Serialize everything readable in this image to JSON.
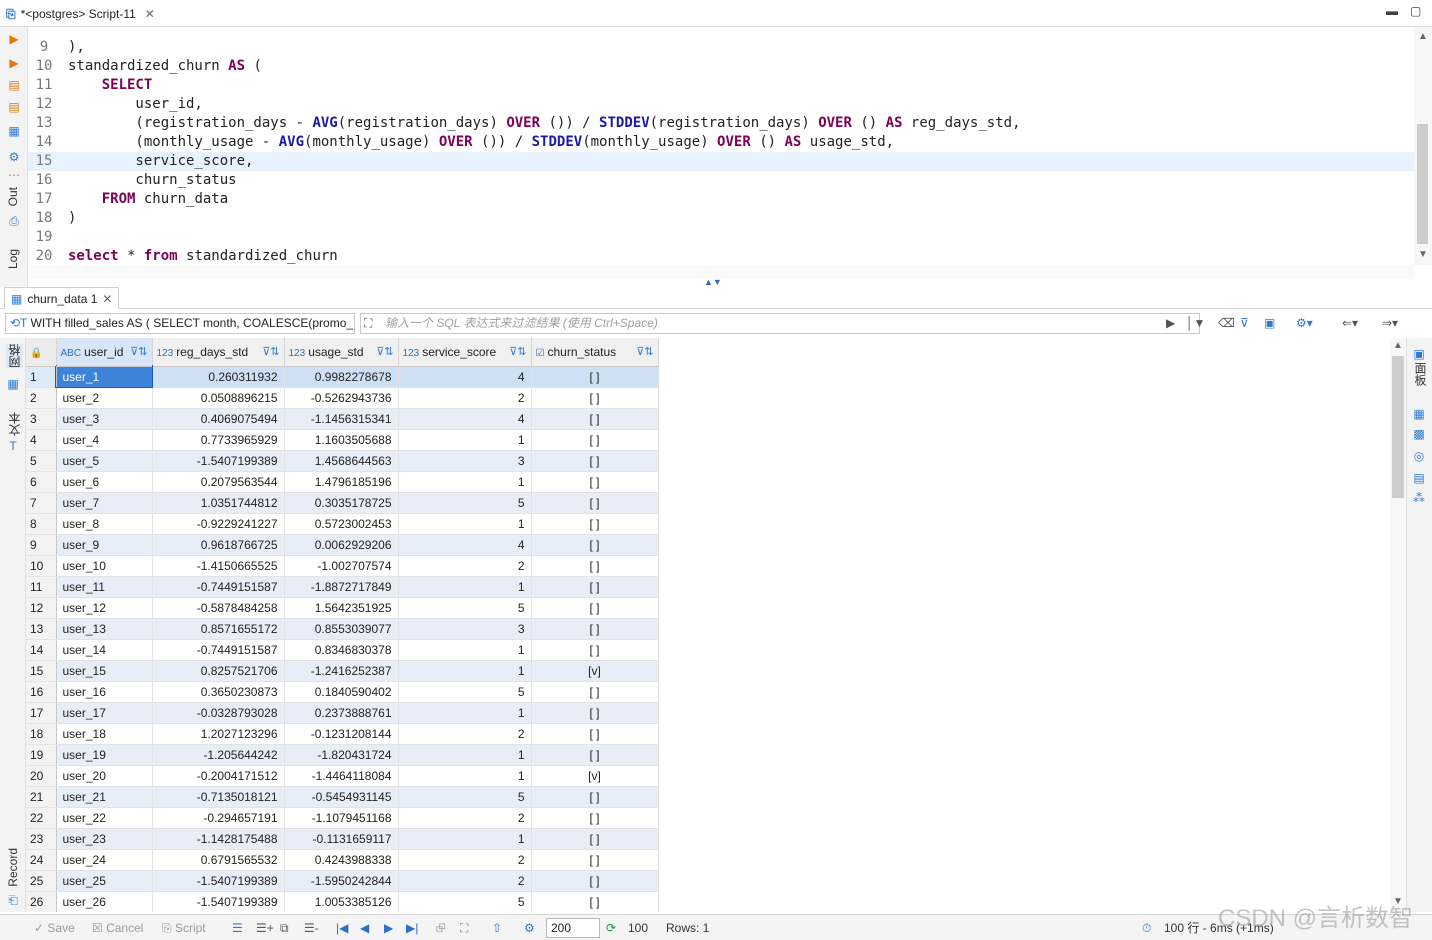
{
  "editor": {
    "tab_title": "*<postgres> Script-11",
    "lines": [
      {
        "n": "9",
        "parts": [
          {
            "t": "),",
            "k": ""
          }
        ]
      },
      {
        "n": "10",
        "parts": [
          {
            "t": "standardized_churn ",
            "k": ""
          },
          {
            "t": "AS",
            "k": "kw"
          },
          {
            "t": " (",
            "k": ""
          }
        ]
      },
      {
        "n": "11",
        "parts": [
          {
            "t": "    ",
            "k": ""
          },
          {
            "t": "SELECT",
            "k": "kw"
          }
        ]
      },
      {
        "n": "12",
        "parts": [
          {
            "t": "        user_id,",
            "k": ""
          }
        ]
      },
      {
        "n": "13",
        "parts": [
          {
            "t": "        (registration_days - ",
            "k": ""
          },
          {
            "t": "AVG",
            "k": "kw2"
          },
          {
            "t": "(registration_days) ",
            "k": ""
          },
          {
            "t": "OVER",
            "k": "kw"
          },
          {
            "t": " ()) / ",
            "k": ""
          },
          {
            "t": "STDDEV",
            "k": "kw2"
          },
          {
            "t": "(registration_days) ",
            "k": ""
          },
          {
            "t": "OVER",
            "k": "kw"
          },
          {
            "t": " () ",
            "k": ""
          },
          {
            "t": "AS",
            "k": "kw"
          },
          {
            "t": " reg_days_std,",
            "k": ""
          }
        ]
      },
      {
        "n": "14",
        "parts": [
          {
            "t": "        (monthly_usage - ",
            "k": ""
          },
          {
            "t": "AVG",
            "k": "kw2"
          },
          {
            "t": "(monthly_usage) ",
            "k": ""
          },
          {
            "t": "OVER",
            "k": "kw"
          },
          {
            "t": " ()) / ",
            "k": ""
          },
          {
            "t": "STDDEV",
            "k": "kw2"
          },
          {
            "t": "(monthly_usage) ",
            "k": ""
          },
          {
            "t": "OVER",
            "k": "kw"
          },
          {
            "t": " () ",
            "k": ""
          },
          {
            "t": "AS",
            "k": "kw"
          },
          {
            "t": " usage_std,",
            "k": ""
          }
        ]
      },
      {
        "n": "15",
        "parts": [
          {
            "t": "        service_score,",
            "k": ""
          }
        ],
        "current": true
      },
      {
        "n": "16",
        "parts": [
          {
            "t": "        churn_status",
            "k": ""
          }
        ]
      },
      {
        "n": "17",
        "parts": [
          {
            "t": "    ",
            "k": ""
          },
          {
            "t": "FROM",
            "k": "kw"
          },
          {
            "t": " churn_data",
            "k": ""
          }
        ]
      },
      {
        "n": "18",
        "parts": [
          {
            "t": ")",
            "k": ""
          }
        ]
      },
      {
        "n": "19",
        "parts": []
      },
      {
        "n": "20",
        "parts": [
          {
            "t": "select",
            "k": "kw"
          },
          {
            "t": " * ",
            "k": ""
          },
          {
            "t": "from",
            "k": "kw"
          },
          {
            "t": " standardized_churn",
            "k": ""
          }
        ]
      }
    ]
  },
  "left_toolbar": {
    "out_label": "Out",
    "log_label": "Log"
  },
  "results": {
    "tab_title": "churn_data 1",
    "query_text": "WITH filled_sales AS ( SELECT month, COALESCE(promo_",
    "filter_placeholder": "输入一个 SQL 表达式来过滤结果 (使用 Ctrl+Space)",
    "side_labels": {
      "grid": "网格",
      "text": "文本",
      "record": "Record"
    },
    "right_panel_label": "面板",
    "columns": [
      {
        "type": "ABC",
        "name": "user_id"
      },
      {
        "type": "123",
        "name": "reg_days_std"
      },
      {
        "type": "123",
        "name": "usage_std"
      },
      {
        "type": "123",
        "name": "service_score"
      },
      {
        "type": "☑",
        "name": "churn_status"
      }
    ],
    "rows": [
      [
        "1",
        "user_1",
        "0.260311932",
        "0.9982278678",
        "4",
        "[ ]"
      ],
      [
        "2",
        "user_2",
        "0.0508896215",
        "-0.5262943736",
        "2",
        "[ ]"
      ],
      [
        "3",
        "user_3",
        "0.4069075494",
        "-1.1456315341",
        "4",
        "[ ]"
      ],
      [
        "4",
        "user_4",
        "0.7733965929",
        "1.1603505688",
        "1",
        "[ ]"
      ],
      [
        "5",
        "user_5",
        "-1.5407199389",
        "1.4568644563",
        "3",
        "[ ]"
      ],
      [
        "6",
        "user_6",
        "0.2079563544",
        "1.4796185196",
        "1",
        "[ ]"
      ],
      [
        "7",
        "user_7",
        "1.0351744812",
        "0.3035178725",
        "5",
        "[ ]"
      ],
      [
        "8",
        "user_8",
        "-0.9229241227",
        "0.5723002453",
        "1",
        "[ ]"
      ],
      [
        "9",
        "user_9",
        "0.9618766725",
        "0.0062929206",
        "4",
        "[ ]"
      ],
      [
        "10",
        "user_10",
        "-1.4150665525",
        "-1.002707574",
        "2",
        "[ ]"
      ],
      [
        "11",
        "user_11",
        "-0.7449151587",
        "-1.8872717849",
        "1",
        "[ ]"
      ],
      [
        "12",
        "user_12",
        "-0.5878484258",
        "1.5642351925",
        "5",
        "[ ]"
      ],
      [
        "13",
        "user_13",
        "0.8571655172",
        "0.8553039077",
        "3",
        "[ ]"
      ],
      [
        "14",
        "user_14",
        "-0.7449151587",
        "0.8346830378",
        "1",
        "[ ]"
      ],
      [
        "15",
        "user_15",
        "0.8257521706",
        "-1.2416252387",
        "1",
        "[v]"
      ],
      [
        "16",
        "user_16",
        "0.3650230873",
        "0.1840590402",
        "5",
        "[ ]"
      ],
      [
        "17",
        "user_17",
        "-0.0328793028",
        "0.2373888761",
        "1",
        "[ ]"
      ],
      [
        "18",
        "user_18",
        "1.2027123296",
        "-0.1231208144",
        "2",
        "[ ]"
      ],
      [
        "19",
        "user_19",
        "-1.205644242",
        "-1.820431724",
        "1",
        "[ ]"
      ],
      [
        "20",
        "user_20",
        "-0.2004171512",
        "-1.4464118084",
        "1",
        "[v]"
      ],
      [
        "21",
        "user_21",
        "-0.7135018121",
        "-0.5454931145",
        "5",
        "[ ]"
      ],
      [
        "22",
        "user_22",
        "-0.294657191",
        "-1.1079451168",
        "2",
        "[ ]"
      ],
      [
        "23",
        "user_23",
        "-1.1428175488",
        "-0.1131659117",
        "1",
        "[ ]"
      ],
      [
        "24",
        "user_24",
        "0.6791565532",
        "0.4243988338",
        "2",
        "[ ]"
      ],
      [
        "25",
        "user_25",
        "-1.5407199389",
        "-1.5950242844",
        "2",
        "[ ]"
      ],
      [
        "26",
        "user_26",
        "-1.5407199389",
        "1.0053385126",
        "5",
        "[ ]"
      ]
    ]
  },
  "statusbar": {
    "save": "Save",
    "cancel": "Cancel",
    "script": "Script",
    "fetch_size": "200",
    "fetch_count": "100",
    "rows": "Rows: 1",
    "timing": "100 行 - 6ms (+1ms)"
  },
  "watermark": "CSDN @言析数智",
  "colors": {
    "accent": "#2b7ad6",
    "keyword": "#7f0055",
    "function": "#1a1aa6",
    "selected_cell": "#3d83d8"
  }
}
